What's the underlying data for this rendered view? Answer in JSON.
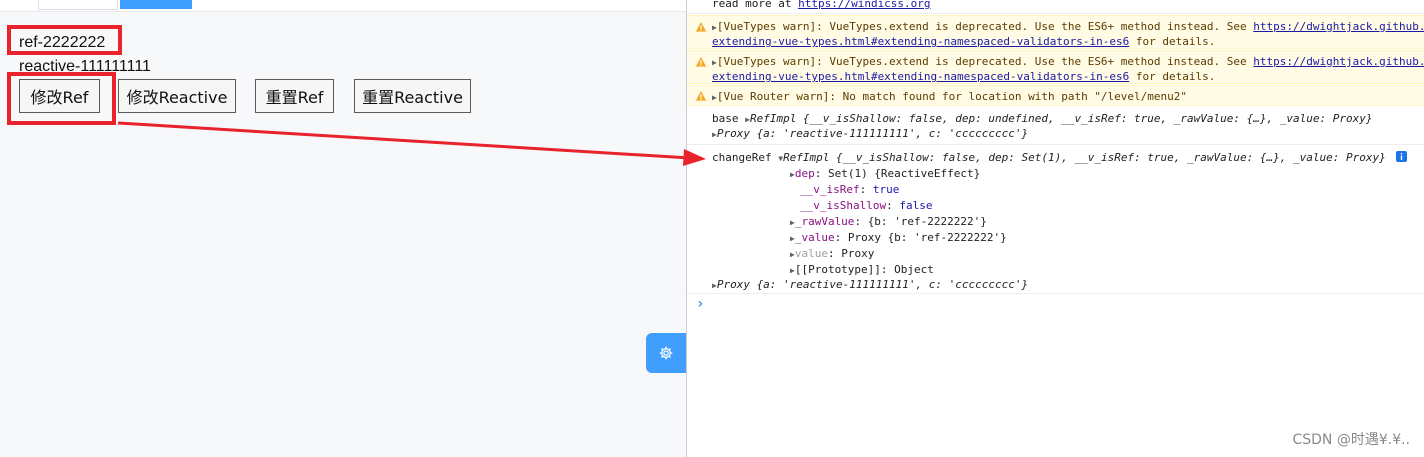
{
  "app": {
    "ref_text": "ref-2222222",
    "reactive_text": "reactive-111111111",
    "buttons": {
      "modify_ref": "修改Ref",
      "modify_reactive": "修改Reactive",
      "reset_ref": "重置Ref",
      "reset_reactive": "重置Reactive"
    },
    "settings_icon": "gear-icon",
    "accent_color": "#409eff",
    "highlight_color": "#e8232b"
  },
  "console": {
    "top_partial": {
      "prefix": "read more at ",
      "link": "https://windicss.org"
    },
    "warnings": [
      {
        "line1_text": "[VueTypes warn]: VueTypes.extend is deprecated. Use the ES6+ method instead. See ",
        "line1_link": "https://dwightjack.github.",
        "line2_link": "extending-vue-types.html#extending-namespaced-validators-in-es6",
        "line2_text": " for details."
      },
      {
        "line1_text": "[VueTypes warn]: VueTypes.extend is deprecated. Use the ES6+ method instead. See ",
        "line1_link": "https://dwightjack.github.",
        "line2_link": "extending-vue-types.html#extending-namespaced-validators-in-es6",
        "line2_text": " for details."
      },
      {
        "line1_text": "[Vue Router warn]: No match found for location with path \"/level/menu2\""
      }
    ],
    "base_log": {
      "label": "base",
      "summary": "RefImpl {__v_isShallow: false, dep: undefined, __v_isRef: true, _rawValue: {…}, _value: Proxy}",
      "proxy": "Proxy {a: 'reactive-111111111', c: 'ccccccccc'}"
    },
    "change_log": {
      "label": "changeRef",
      "summary": "RefImpl {__v_isShallow: false, dep: Set(1), __v_isRef: true, _rawValue: {…}, _value: Proxy}",
      "info_icon": "info-icon",
      "props": [
        {
          "key": "dep",
          "value": "Set(1) {ReactiveEffect}"
        },
        {
          "key": "__v_isRef",
          "value": "true"
        },
        {
          "key": "__v_isShallow",
          "value": "false"
        },
        {
          "key": "_rawValue",
          "value": "{b: 'ref-2222222'}"
        },
        {
          "key": "_value",
          "value": "Proxy {b: 'ref-2222222'}"
        },
        {
          "key": "value",
          "value": "Proxy"
        },
        {
          "key": "[[Prototype]]",
          "value": "Object"
        }
      ],
      "proxy": "Proxy {a: 'reactive-111111111', c: 'ccccccccc'}"
    },
    "prompt_symbol": "›"
  },
  "watermark": "CSDN @时遇¥.¥.."
}
